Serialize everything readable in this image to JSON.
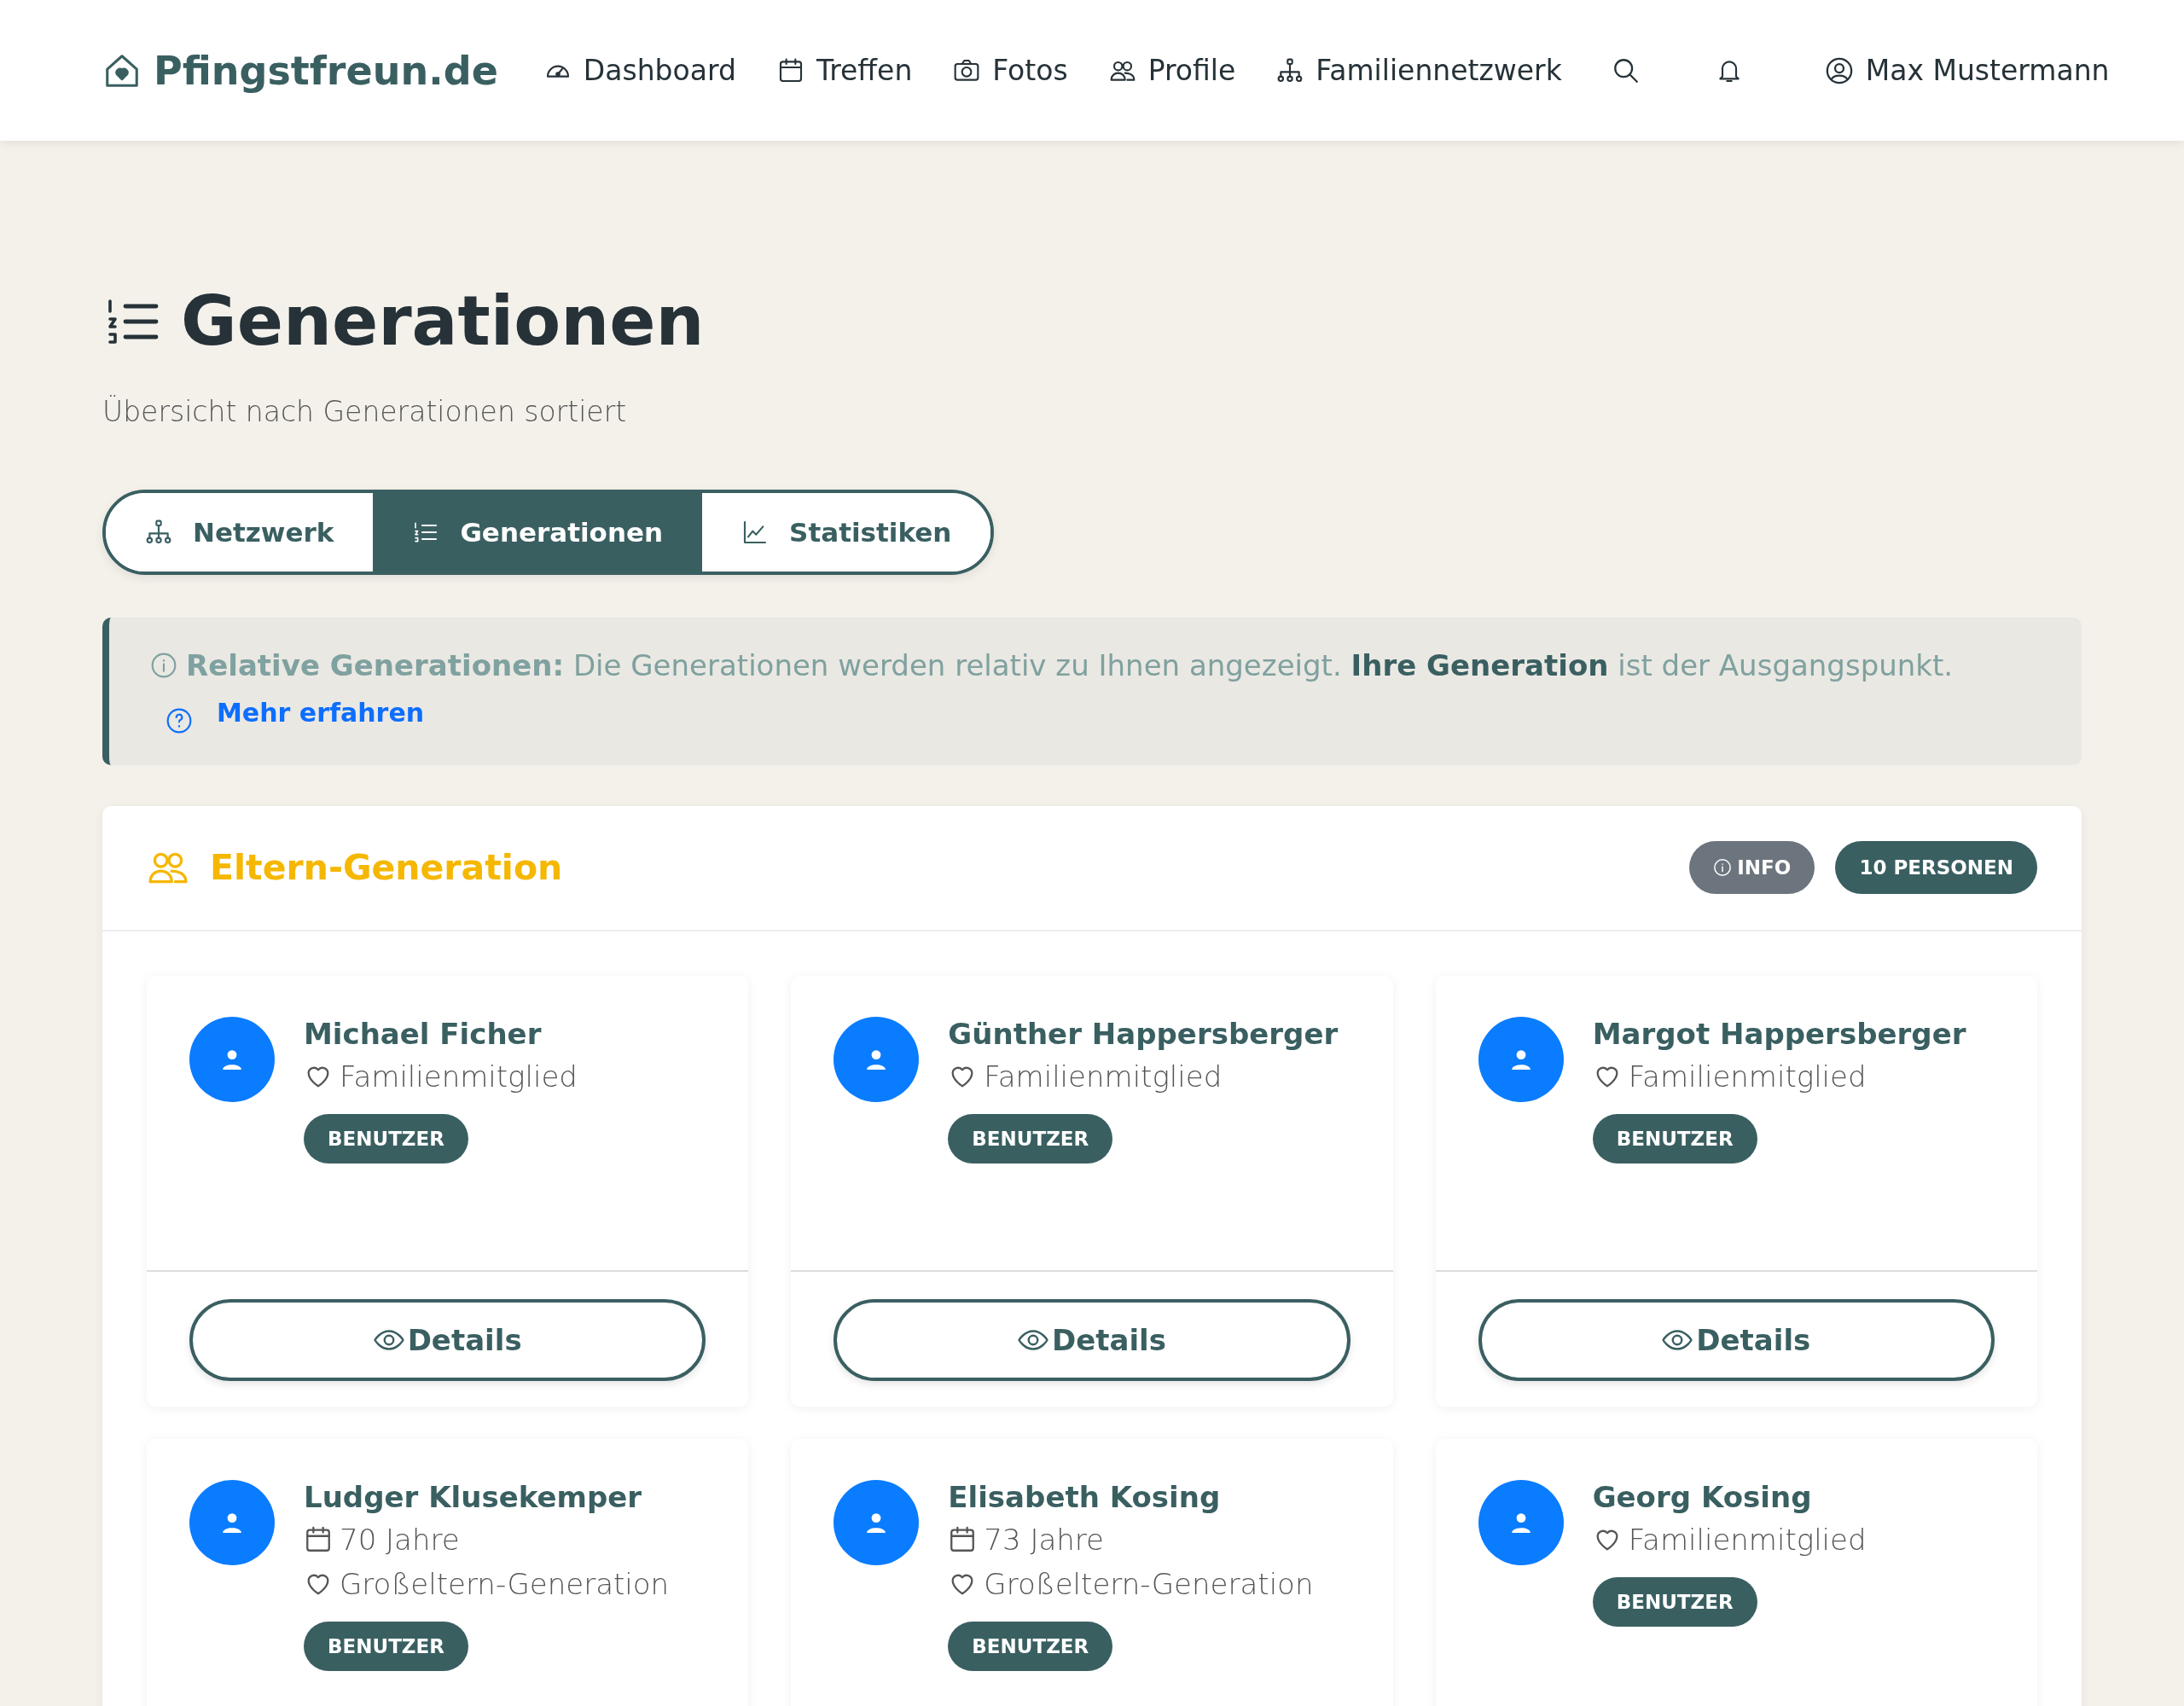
{
  "brand": {
    "name": "Pfingstfreun.de"
  },
  "nav": [
    {
      "label": "Dashboard"
    },
    {
      "label": "Treffen"
    },
    {
      "label": "Fotos"
    },
    {
      "label": "Profile"
    },
    {
      "label": "Familiennetzwerk"
    }
  ],
  "user": {
    "name": "Max Mustermann"
  },
  "page": {
    "title": "Generationen",
    "subtitle": "Übersicht nach Generationen sortiert"
  },
  "tabs": [
    {
      "label": "Netzwerk",
      "selected": false
    },
    {
      "label": "Generationen",
      "selected": true
    },
    {
      "label": "Statistiken",
      "selected": false
    }
  ],
  "info": {
    "text": "**Relative Generationen:** Die Generationen werden relativ zu Ihnen angezeigt. **Ihre Generation** ist der Ausgangspunkt.",
    "link": "Mehr erfahren"
  },
  "generation": {
    "title": "Eltern-Generation",
    "info_badge": "INFO",
    "count": "10 PERSONEN",
    "persons": [
      {
        "name": "Michael Ficher",
        "lines": [
          {
            "kind": "role",
            "text": "Familienmitglied"
          }
        ],
        "badge": "BENUTZER",
        "button": "Details"
      },
      {
        "name": "Günther Happersberger",
        "lines": [
          {
            "kind": "role",
            "text": "Familienmitglied"
          }
        ],
        "badge": "BENUTZER",
        "button": "Details"
      },
      {
        "name": "Margot Happersberger",
        "lines": [
          {
            "kind": "role",
            "text": "Familienmitglied"
          }
        ],
        "badge": "BENUTZER",
        "button": "Details"
      },
      {
        "name": "Ludger Klusekemper",
        "lines": [
          {
            "kind": "age",
            "text": "70 Jahre"
          },
          {
            "kind": "role",
            "text": "Großeltern-Generation"
          }
        ],
        "badge": "BENUTZER"
      },
      {
        "name": "Elisabeth Kosing",
        "lines": [
          {
            "kind": "age",
            "text": "73 Jahre"
          },
          {
            "kind": "role",
            "text": "Großeltern-Generation"
          }
        ],
        "badge": "BENUTZER"
      },
      {
        "name": "Georg Kosing",
        "lines": [
          {
            "kind": "role",
            "text": "Familienmitglied"
          }
        ],
        "badge": "BENUTZER"
      }
    ]
  }
}
